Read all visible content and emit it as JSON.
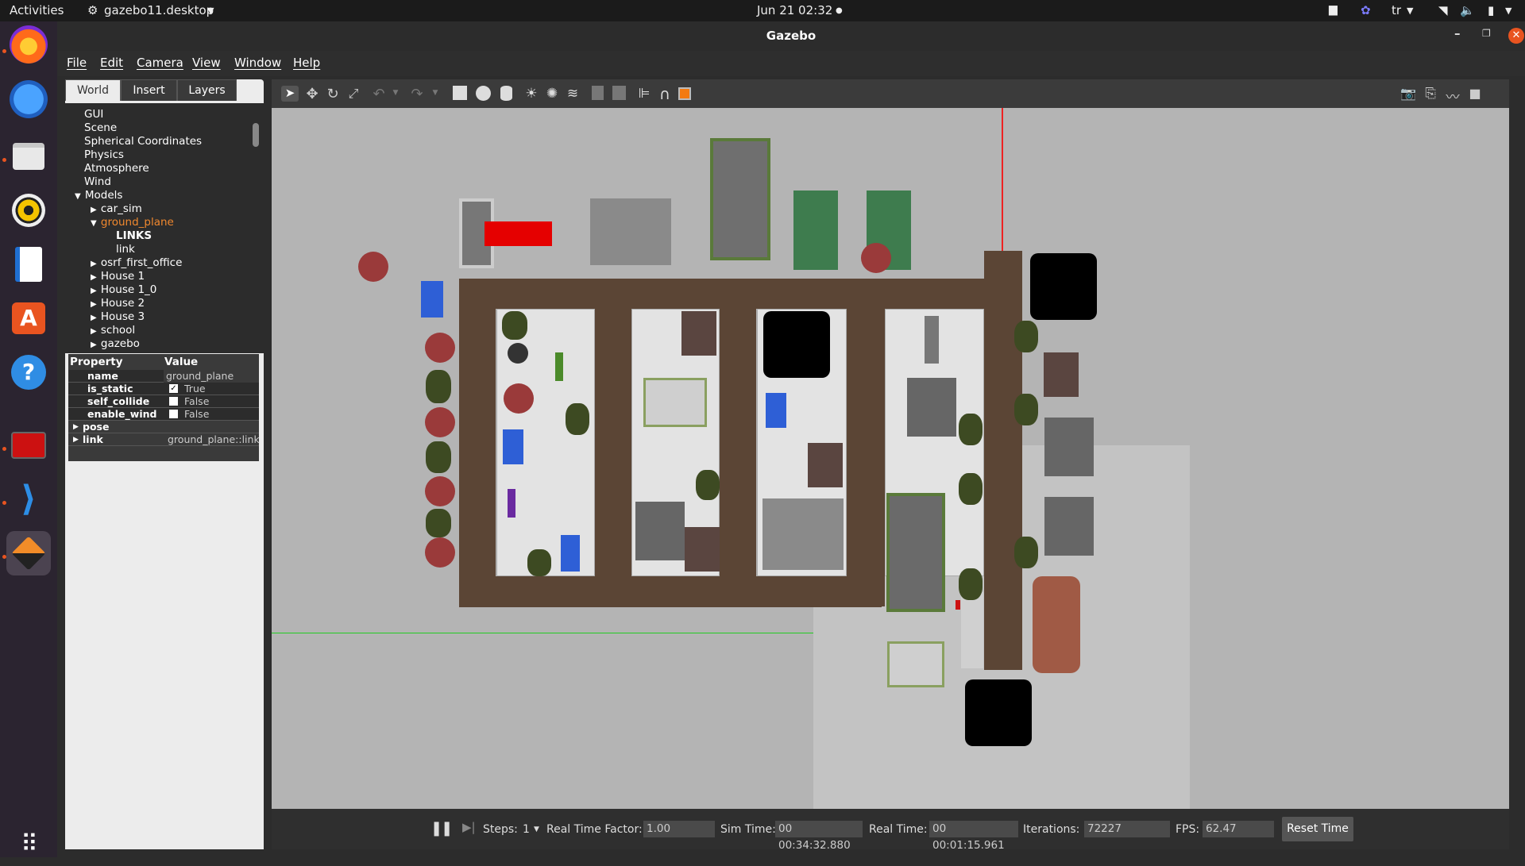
{
  "topbar": {
    "activities": "Activities",
    "app_name": "gazebo11.desktop",
    "clock": "Jun 21  02:32",
    "language": "tr"
  },
  "window": {
    "title": "Gazebo"
  },
  "menu": [
    "File",
    "Edit",
    "Camera",
    "View",
    "Window",
    "Help"
  ],
  "tabs": [
    "World",
    "Insert",
    "Layers"
  ],
  "tree": [
    {
      "label": "GUI",
      "indent": 0,
      "arrow": ""
    },
    {
      "label": "Scene",
      "indent": 0,
      "arrow": ""
    },
    {
      "label": "Spherical Coordinates",
      "indent": 0,
      "arrow": ""
    },
    {
      "label": "Physics",
      "indent": 0,
      "arrow": ""
    },
    {
      "label": "Atmosphere",
      "indent": 0,
      "arrow": ""
    },
    {
      "label": "Wind",
      "indent": 0,
      "arrow": ""
    },
    {
      "label": "Models",
      "indent": 0,
      "arrow": "open"
    },
    {
      "label": "car_sim",
      "indent": 1,
      "arrow": "closed"
    },
    {
      "label": "ground_plane",
      "indent": 1,
      "arrow": "open",
      "selected": true
    },
    {
      "label": "LINKS",
      "indent": 2,
      "arrow": "",
      "bold": true
    },
    {
      "label": "link",
      "indent": 2,
      "arrow": ""
    },
    {
      "label": "osrf_first_office",
      "indent": 1,
      "arrow": "closed"
    },
    {
      "label": "House 1",
      "indent": 1,
      "arrow": "closed"
    },
    {
      "label": "House 1_0",
      "indent": 1,
      "arrow": "closed"
    },
    {
      "label": "House 2",
      "indent": 1,
      "arrow": "closed"
    },
    {
      "label": "House 3",
      "indent": 1,
      "arrow": "closed"
    },
    {
      "label": "school",
      "indent": 1,
      "arrow": "closed"
    },
    {
      "label": "gazebo",
      "indent": 1,
      "arrow": "closed"
    }
  ],
  "properties": {
    "header_property": "Property",
    "header_value": "Value",
    "rows": [
      {
        "key": "name",
        "value": "ground_plane",
        "type": "text"
      },
      {
        "key": "is_static",
        "value": "True",
        "type": "check",
        "checked": true
      },
      {
        "key": "self_collide",
        "value": "False",
        "type": "check",
        "checked": false
      },
      {
        "key": "enable_wind",
        "value": "False",
        "type": "check",
        "checked": false
      },
      {
        "key": "pose",
        "value": "",
        "type": "group"
      },
      {
        "key": "link",
        "value": "ground_plane::link",
        "type": "group"
      }
    ]
  },
  "status": {
    "steps_label": "Steps:",
    "steps_value": "1",
    "rtf_label": "Real Time Factor:",
    "rtf_value": "1.00",
    "sim_label": "Sim Time:",
    "sim_value": "00 00:34:32.880",
    "real_label": "Real Time:",
    "real_value": "00 00:01:15.961",
    "iter_label": "Iterations:",
    "iter_value": "72227",
    "fps_label": "FPS:",
    "fps_value": "62.47",
    "reset_label": "Reset Time"
  },
  "colors": {
    "accent": "#e95420",
    "selected_tree": "#f0882e",
    "dirt_road": "#5b4535",
    "ground": "#b4b4b4"
  }
}
